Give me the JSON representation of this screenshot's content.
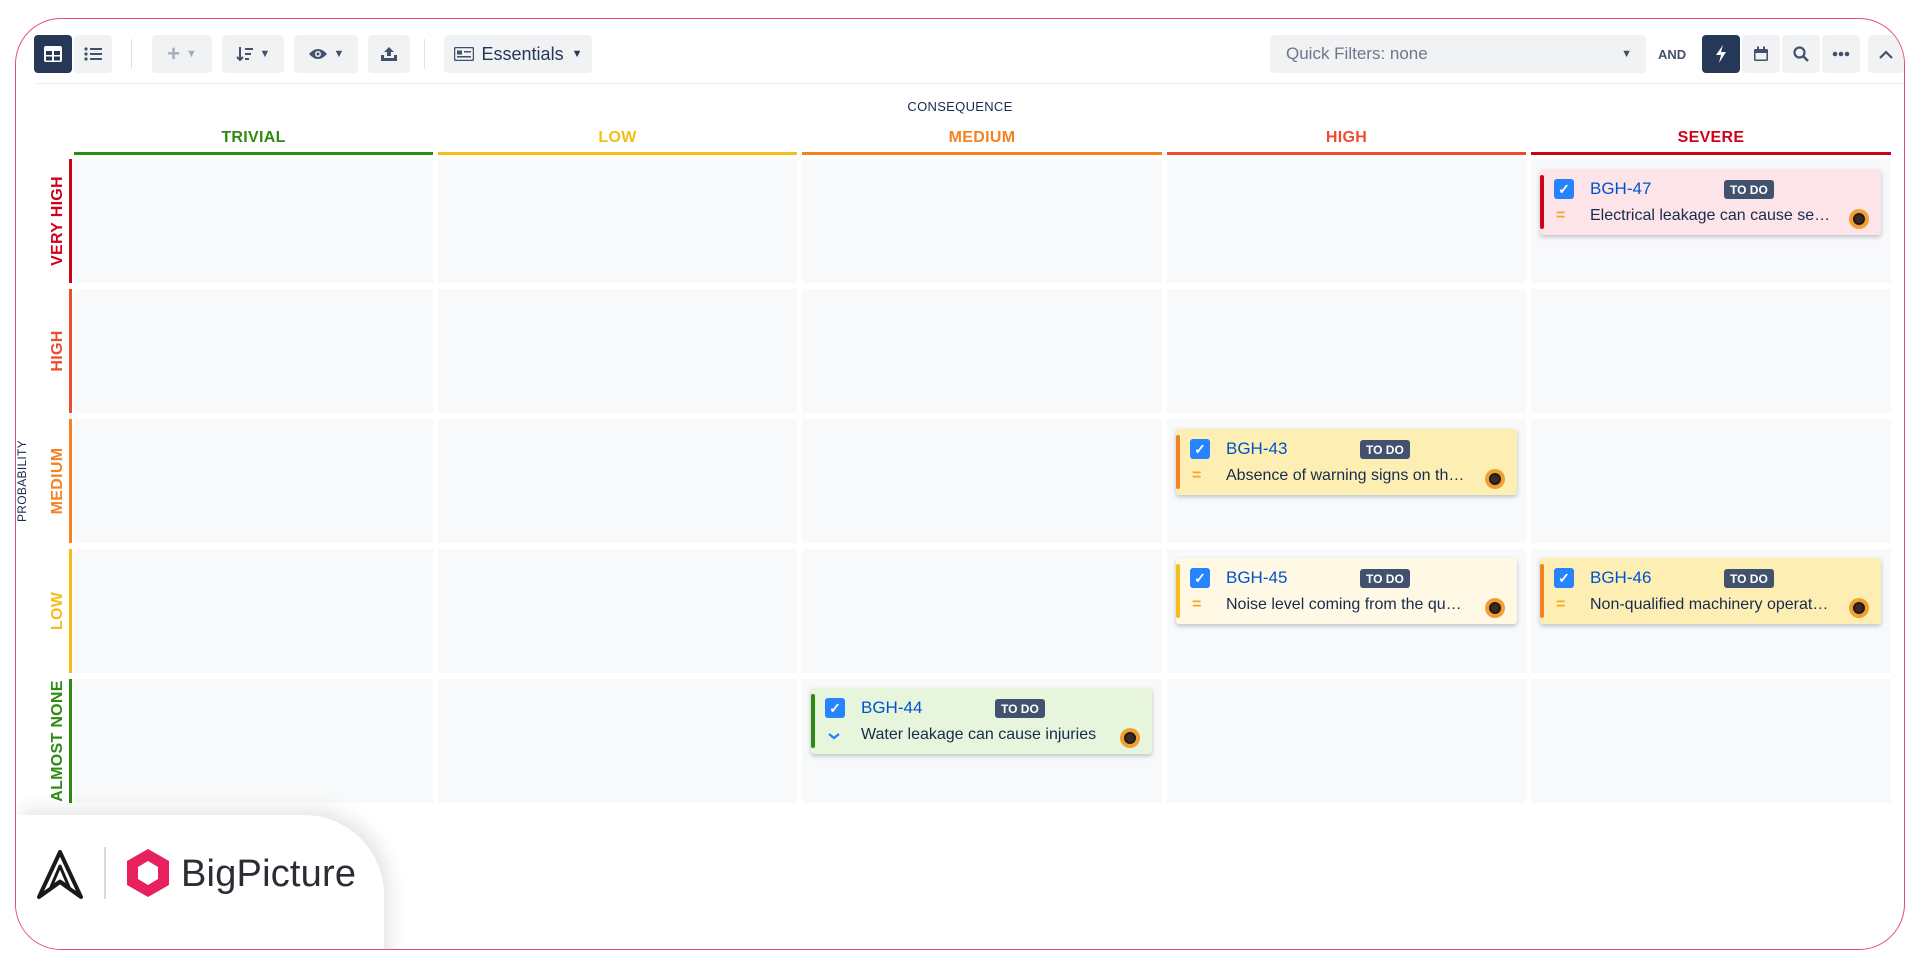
{
  "toolbar": {
    "view_mode": "Essentials",
    "quick_filter_label": "Quick Filters: none",
    "and_label": "AND",
    "icons": [
      "board-view-icon",
      "list-view-icon",
      "add-icon",
      "sort-icon",
      "visibility-icon",
      "export-icon",
      "card-view-icon",
      "lightning-icon",
      "calendar-icon",
      "search-icon",
      "more-icon",
      "collapse-icon"
    ]
  },
  "matrix": {
    "x_axis_title": "CONSEQUENCE",
    "y_axis_title": "PROBABILITY",
    "columns": [
      {
        "label": "TRIVIAL",
        "color": "#2e8b12"
      },
      {
        "label": "LOW",
        "color": "#f6bd16"
      },
      {
        "label": "MEDIUM",
        "color": "#f5821f"
      },
      {
        "label": "HIGH",
        "color": "#ee4c2e"
      },
      {
        "label": "SEVERE",
        "color": "#d0021b"
      }
    ],
    "rows": [
      {
        "label": "VERY HIGH",
        "color": "#d0021b"
      },
      {
        "label": "HIGH",
        "color": "#ee4c2e"
      },
      {
        "label": "MEDIUM",
        "color": "#f5821f"
      },
      {
        "label": "LOW",
        "color": "#f6bd16"
      },
      {
        "label": "ALMOST NONE",
        "color": "#2e8b12"
      }
    ]
  },
  "cards": [
    {
      "key": "BGH-47",
      "status": "TO DO",
      "summary": "Electrical leakage can cause severe injuries",
      "row": "VERY HIGH",
      "column": "SEVERE",
      "priority": "medium",
      "bg": "#fde4e8",
      "stripe": "#d0021b"
    },
    {
      "key": "BGH-43",
      "status": "TO DO",
      "summary": "Absence of warning signs on the construction site",
      "row": "MEDIUM",
      "column": "HIGH",
      "priority": "medium",
      "bg": "#fdefb4",
      "stripe": "#f5821f"
    },
    {
      "key": "BGH-45",
      "status": "TO DO",
      "summary": "Noise level coming from the quarry",
      "row": "LOW",
      "column": "HIGH",
      "priority": "medium",
      "bg": "#fff8e5",
      "stripe": "#f6bd16"
    },
    {
      "key": "BGH-46",
      "status": "TO DO",
      "summary": "Non-qualified machinery operators",
      "row": "LOW",
      "column": "SEVERE",
      "priority": "medium",
      "bg": "#fdefb4",
      "stripe": "#f5821f"
    },
    {
      "key": "BGH-44",
      "status": "TO DO",
      "summary": "Water leakage can cause injuries",
      "row": "ALMOST NONE",
      "column": "MEDIUM",
      "priority": "low",
      "bg": "#e7f5dd",
      "stripe": "#2e8b12"
    }
  ],
  "branding": {
    "product_name": "BigPicture",
    "brand_color": "#e8215c"
  }
}
